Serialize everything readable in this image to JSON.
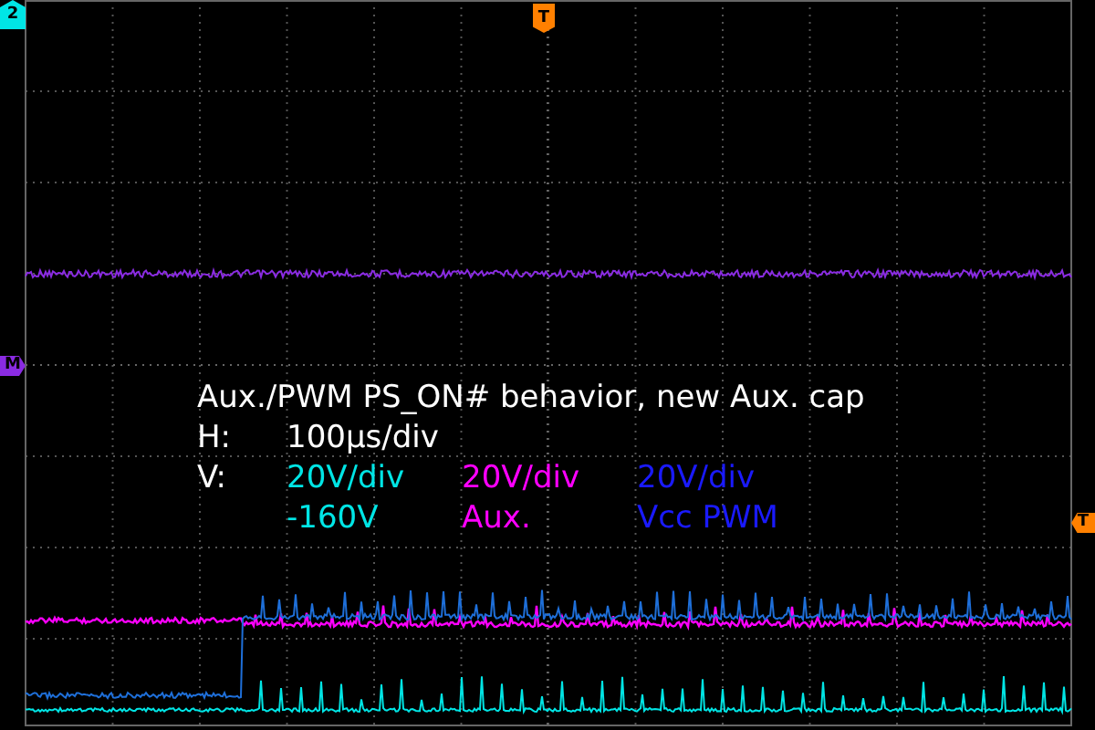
{
  "markers": [
    {
      "label": "2",
      "kind": "channel",
      "color": "#00e5e5"
    },
    {
      "label": "T",
      "kind": "trigger-top",
      "color": "#ff8000"
    },
    {
      "label": "M",
      "kind": "math",
      "color": "#8a2be2"
    },
    {
      "label": "T",
      "kind": "trigger-level",
      "color": "#ff8000"
    }
  ],
  "annotation": {
    "title": "Aux./PWM PS_ON# behavior, new Aux. cap",
    "h_label": "H:",
    "h_value": "100µs/div",
    "v_label": "V:",
    "channels": [
      {
        "scale": "20V/div",
        "name": "-160V",
        "color": "#00e5e5"
      },
      {
        "scale": "20V/div",
        "name": "Aux.",
        "color": "#ff00ff"
      },
      {
        "scale": "20V/div",
        "name": "Vcc PWM",
        "color": "#1a1aff"
      }
    ]
  }
}
